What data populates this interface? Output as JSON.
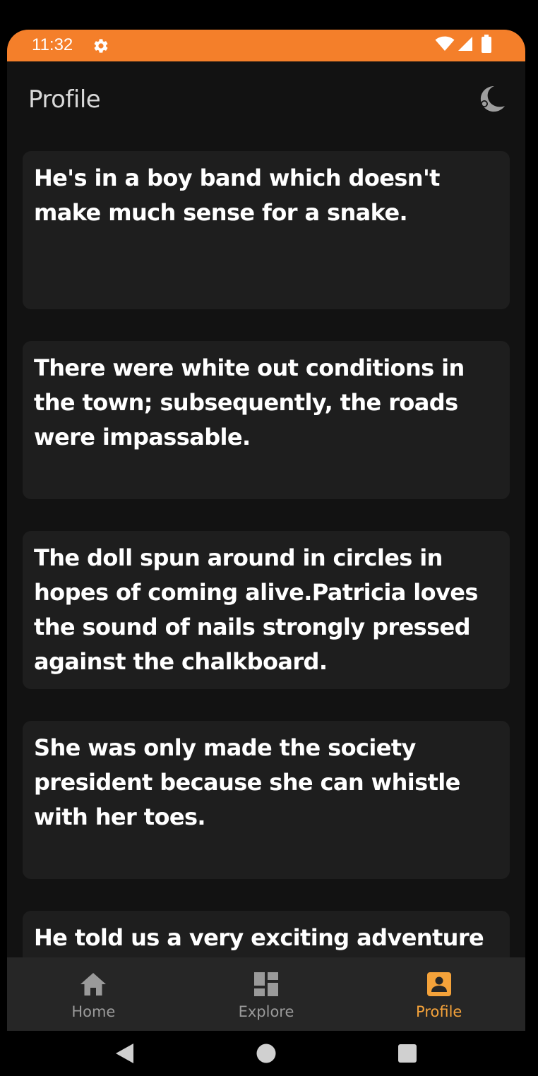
{
  "status_bar": {
    "time": "11:32",
    "color": "#F47F2A",
    "icons": [
      "settings-gear-icon",
      "wifi-icon",
      "cell-signal-icon",
      "battery-icon"
    ]
  },
  "header": {
    "title": "Profile",
    "theme_toggle_icon": "moon-icon"
  },
  "feed": {
    "cards": [
      {
        "text": "He's in a boy band which doesn't make much sense for a snake."
      },
      {
        "text": "There were white out conditions in the town; subsequently, the roads were impassable."
      },
      {
        "text": "The doll spun around in circles in hopes of coming alive.Patricia loves the sound of nails strongly pressed against the chalkboard."
      },
      {
        "text": "She was only made the society president because she can whistle with her toes."
      },
      {
        "text": "He told us a very exciting adventure"
      }
    ]
  },
  "bottom_nav": {
    "active_color": "#F4A23A",
    "items": [
      {
        "label": "Home",
        "icon": "home-icon",
        "active": false
      },
      {
        "label": "Explore",
        "icon": "dashboard-icon",
        "active": false
      },
      {
        "label": "Profile",
        "icon": "account-box-icon",
        "active": true
      }
    ]
  },
  "system_nav": {
    "buttons": [
      "back-triangle-icon",
      "home-circle-icon",
      "recents-square-icon"
    ]
  }
}
